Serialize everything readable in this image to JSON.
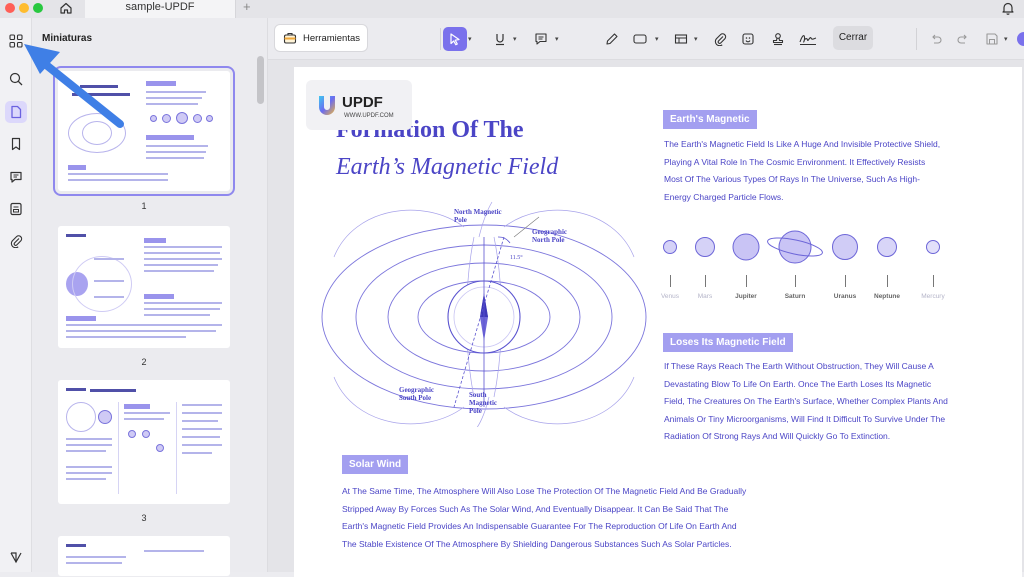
{
  "tab": {
    "title": "sample-UPDF"
  },
  "sidebar": {
    "title": "Miniaturas"
  },
  "thumbnails": [
    {
      "page": "1",
      "selected": true
    },
    {
      "page": "2",
      "selected": false
    },
    {
      "page": "3",
      "selected": false
    }
  ],
  "toolbar": {
    "tools_label": "Herramientas",
    "close_label": "Cerrar"
  },
  "document": {
    "logo_name": "UPDF",
    "logo_url": "WWW.UPDF.COM",
    "title_line1": "Formation Of The",
    "title_line2": "Earth’s Magnetic Field",
    "diagram_labels": {
      "north_magnetic_pole": "North Magnetic Pole",
      "geographic_north_pole": "Geographic North Pole",
      "geographic_south_pole": "Geographic South Pole",
      "south_magnetic_pole": "South Magnetic Pole",
      "angle": "11.5°"
    },
    "section_magnetic": {
      "heading": "Earth's Magnetic",
      "body": "The Earth's Magnetic Field Is Like A Huge And Invisible Protective Shield, Playing A Vital Role In The Cosmic Environment. It Effectively Resists Most Of The Various Types Of Rays In The Universe, Such As High-Energy Charged Particle Flows."
    },
    "planets": [
      {
        "name": "Venus",
        "color": "#d5d2f7"
      },
      {
        "name": "Mars",
        "color": "#d5d2f7"
      },
      {
        "name": "Jupiter",
        "color": "#c9c4f5"
      },
      {
        "name": "Saturn",
        "color": "#c9c4f5"
      },
      {
        "name": "Uranus",
        "color": "#d0ccf6"
      },
      {
        "name": "Neptune",
        "color": "#d8d5f8"
      },
      {
        "name": "Mercury",
        "color": "#e2e0fa"
      }
    ],
    "section_loses": {
      "heading": "Loses Its Magnetic Field",
      "body": "If These Rays Reach The Earth Without Obstruction, They Will Cause A Devastating Blow To Life On Earth. Once The Earth Loses Its Magnetic Field, The Creatures On The Earth's Surface, Whether Complex Plants And Animals Or Tiny Microorganisms, Will Find It Difficult To Survive Under The Radiation Of Strong Rays And Will Quickly Go To Extinction."
    },
    "section_solar": {
      "heading": "Solar Wind",
      "body": "At The Same Time, The Atmosphere Will Also Lose The Protection Of The Magnetic Field And Be Gradually Stripped Away By Forces Such As The Solar Wind, And Eventually Disappear. It Can Be Said That The Earth's Magnetic Field Provides An Indispensable Guarantee For The Reproduction Of Life On Earth And The Stable Existence Of The Atmosphere By Shielding Dangerous Substances Such As Solar Particles."
    }
  },
  "colors": {
    "accent": "#7a71ec",
    "document_text": "#4b45c6",
    "section_bg": "#a39ff0",
    "arrow": "#3f7fe6"
  }
}
